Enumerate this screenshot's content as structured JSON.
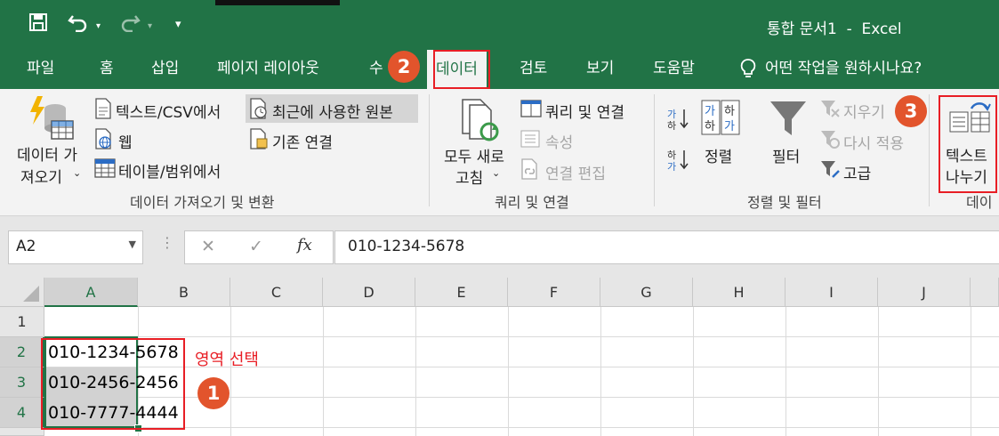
{
  "window": {
    "title": "통합 문서1  -  Excel"
  },
  "tabs": [
    {
      "label": "파일"
    },
    {
      "label": "홈"
    },
    {
      "label": "삽입"
    },
    {
      "label": "페이지 레이아웃"
    },
    {
      "label": "수"
    },
    {
      "label": "데이터"
    },
    {
      "label": "검토"
    },
    {
      "label": "보기"
    },
    {
      "label": "도움말"
    }
  ],
  "tell_me": "어떤 작업을 원하시나요?",
  "ribbon": {
    "get_data": {
      "btn_line1": "데이터 가",
      "btn_line2": "져오기",
      "from_text_csv": "텍스트/CSV에서",
      "from_web": "웹",
      "from_table": "테이블/범위에서",
      "recent_sources": "최근에 사용한 원본",
      "existing_connections": "기존 연결",
      "group_label": "데이터 가져오기 및 변환"
    },
    "queries": {
      "refresh_line1": "모두 새로",
      "refresh_line2": "고침",
      "queries_connections": "쿼리 및 연결",
      "properties": "속성",
      "edit_links": "연결 편집",
      "group_label": "쿼리 및 연결"
    },
    "sort_filter": {
      "sort_az_icon_text": "가\n하",
      "sort": "정렬",
      "filter": "필터",
      "clear": "지우기",
      "reapply": "다시 적용",
      "advanced": "고급",
      "group_label": "정렬 및 필터"
    },
    "data_tools": {
      "text_to_columns_line1": "텍스트",
      "text_to_columns_line2": "나누기",
      "group_label": "데이"
    }
  },
  "formula_bar": {
    "name_box": "A2",
    "cancel": "✕",
    "enter": "✓",
    "fx": "fx",
    "value": "010-1234-5678"
  },
  "grid": {
    "columns": [
      "A",
      "B",
      "C",
      "D",
      "E",
      "F",
      "G",
      "H",
      "I",
      "J"
    ],
    "rows": [
      "1",
      "2",
      "3",
      "4"
    ],
    "cells": {
      "A2": "010-1234-5678",
      "A3": "010-2456-2456",
      "A4": "010-7777-4444"
    }
  },
  "annotations": {
    "step1": "1",
    "step2": "2",
    "step3": "3",
    "select_range": "영역 선택",
    "accent_color": "#e81e25",
    "badge_color": "#e2542c"
  },
  "colors": {
    "excel_green": "#217346"
  }
}
